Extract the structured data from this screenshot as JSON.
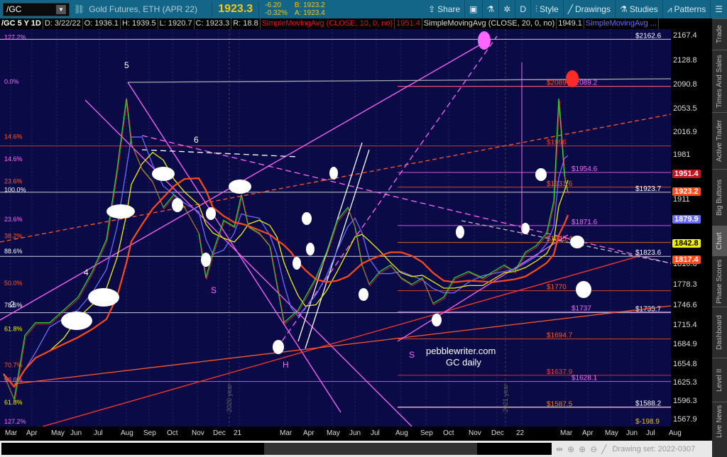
{
  "toolbar": {
    "symbol": "/GC",
    "description": "Gold Futures, ETH (APR 22)",
    "last": "1923.3",
    "change": "-6.20",
    "change_pct": "-0.32%",
    "bid": "B: 1923.2",
    "ask": "A: 1923.4",
    "share": "Share",
    "period": "D",
    "style": "Style",
    "drawings": "Drawings",
    "studies": "Studies",
    "patterns": "Patterns"
  },
  "info": {
    "title": "/GC 5 Y 1D",
    "date": "D: 3/22/22",
    "open": "O: 1936.1",
    "high": "H: 1939.5",
    "low": "L: 1920.7",
    "close": "C: 1923.3",
    "range": "R: 18.8",
    "sma10": "SimpleMovingAvg (CLOSE, 10, 0, no)",
    "sma10_val": "1951.4",
    "sma20": "SimpleMovingAvg (CLOSE, 20, 0, no)",
    "sma20_val": "1949.1",
    "sma3": "SimpleMovingAvg ..."
  },
  "price_axis": {
    "ticks": [
      "2167.4",
      "2128.8",
      "2090.8",
      "2053.5",
      "2016.9",
      "1981",
      "1911",
      "1810.6",
      "1778.3",
      "1746.6",
      "1715.4",
      "1684.9",
      "1654.8",
      "1625.3",
      "1596.3",
      "1567.9"
    ],
    "tags": [
      {
        "label": "1951.4",
        "price": 1951.4,
        "bg": "#c0141e",
        "fg": "#fff"
      },
      {
        "label": "1923.2",
        "price": 1923.2,
        "bg": "#ff4a1a",
        "fg": "#fff"
      },
      {
        "label": "1879.9",
        "price": 1879.9,
        "bg": "#6b6bff",
        "fg": "#fff"
      },
      {
        "label": "1842.8",
        "price": 1842.8,
        "bg": "#f0f000",
        "fg": "#000"
      },
      {
        "label": "1817.4",
        "price": 1817.4,
        "bg": "#ff4a1a",
        "fg": "#fff"
      }
    ]
  },
  "x_axis": [
    "Mar",
    "Apr",
    "May",
    "Jun",
    "Jul",
    "Aug",
    "Sep",
    "Oct",
    "Nov",
    "Dec",
    "21",
    "Mar",
    "Apr",
    "May",
    "Jun",
    "Jul",
    "Aug",
    "Sep",
    "Oct",
    "Nov",
    "Dec",
    "22",
    "Mar",
    "Apr",
    "May",
    "Jun",
    "Jul",
    "Aug"
  ],
  "levels": [
    {
      "price": 2162.6,
      "label": "$2162.6",
      "color": "#ffffff"
    },
    {
      "price": 2089.2,
      "label": "$2089.2",
      "color": "#ff66ff"
    },
    {
      "price": 2089,
      "label": "$2089",
      "color": "#ff5a2a"
    },
    {
      "price": 1996,
      "label": "$1996",
      "color": "#ff3a2a"
    },
    {
      "price": 1954.6,
      "label": "$1954.6",
      "color": "#ff66ff"
    },
    {
      "price": 1931.6,
      "label": "$1931.6",
      "color": "#ff5a2a"
    },
    {
      "price": 1923.7,
      "label": "$1923.7",
      "color": "#ffffff"
    },
    {
      "price": 1871.6,
      "label": "$1871.6",
      "color": "#ff66ff"
    },
    {
      "price": 1845.4,
      "label": "$1845.4",
      "color": "#ff7a2a"
    },
    {
      "price": 1823.6,
      "label": "$1823.6",
      "color": "#ffffff"
    },
    {
      "price": 1770,
      "label": "$1770",
      "color": "#ff5a2a"
    },
    {
      "price": 1737,
      "label": "$1737",
      "color": "#ff66ff"
    },
    {
      "price": 1735.7,
      "label": "$1735.7",
      "color": "#ffffff"
    },
    {
      "price": 1694.7,
      "label": "$1694.7",
      "color": "#ff5a2a"
    },
    {
      "price": 1637.9,
      "label": "$1637.9",
      "color": "#ff3a2a"
    },
    {
      "price": 1628.1,
      "label": "$1628.1",
      "color": "#ff66ff"
    },
    {
      "price": 1587.5,
      "label": "$1587.5",
      "color": "#ff7a2a"
    },
    {
      "price": 1588.2,
      "label": "$1588.2",
      "color": "#ffffff"
    },
    {
      "price": 1552,
      "label": "$-198.9",
      "color": "#f0c000"
    }
  ],
  "fib_labels": [
    {
      "price": 2160,
      "label": "127.2%",
      "color": "#ff66ff"
    },
    {
      "price": 2091,
      "label": "0.0%",
      "color": "#ff66ff"
    },
    {
      "price": 2005,
      "label": "14.6%",
      "color": "#ff5a2a"
    },
    {
      "price": 1970,
      "label": "14.6%",
      "color": "#ff66ff"
    },
    {
      "price": 1935,
      "label": "23.6%",
      "color": "#ff5a2a"
    },
    {
      "price": 1922,
      "label": "100.0%",
      "color": "#ffffff"
    },
    {
      "price": 1876,
      "label": "23.6%",
      "color": "#ff66ff"
    },
    {
      "price": 1850,
      "label": "38.2%",
      "color": "#ff5a2a"
    },
    {
      "price": 1826,
      "label": "88.6%",
      "color": "#ffffff"
    },
    {
      "price": 1776,
      "label": "50.0%",
      "color": "#ff5a2a"
    },
    {
      "price": 1742,
      "label": "78.6%",
      "color": "#ffffff"
    },
    {
      "price": 1705,
      "label": "61.8%",
      "color": "#f0f000"
    },
    {
      "price": 1648,
      "label": "70.7%",
      "color": "#ff5a2a"
    },
    {
      "price": 1625,
      "label": "50.0%",
      "color": "#ff66ff"
    },
    {
      "price": 1590,
      "label": "61.8%",
      "color": "#f0f000"
    },
    {
      "price": 1555,
      "label": "127.2%",
      "color": "#ff66ff"
    }
  ],
  "annotations": {
    "w5": "5",
    "w6": "6",
    "w4": "4",
    "w2": "2",
    "s1": "S",
    "h": "H",
    "s2": "S",
    "site": "pebblewriter.com",
    "subtitle": "GC daily",
    "y2020": "2020 year",
    "y2021": "2021 year"
  },
  "price_series": [
    [
      5,
      1640
    ],
    [
      20,
      1600
    ],
    [
      35,
      1700
    ],
    [
      50,
      1720
    ],
    [
      70,
      1720
    ],
    [
      90,
      1740
    ],
    [
      110,
      1760
    ],
    [
      130,
      1800
    ],
    [
      150,
      1850
    ],
    [
      165,
      1960
    ],
    [
      178,
      2070
    ],
    [
      185,
      2000
    ],
    [
      200,
      1960
    ],
    [
      215,
      1940
    ],
    [
      230,
      1900
    ],
    [
      245,
      1920
    ],
    [
      260,
      1900
    ],
    [
      280,
      1860
    ],
    [
      290,
      1790
    ],
    [
      300,
      1830
    ],
    [
      315,
      1880
    ],
    [
      330,
      1870
    ],
    [
      340,
      1920
    ],
    [
      350,
      1870
    ],
    [
      365,
      1860
    ],
    [
      380,
      1840
    ],
    [
      390,
      1780
    ],
    [
      400,
      1720
    ],
    [
      410,
      1730
    ],
    [
      420,
      1740
    ],
    [
      430,
      1760
    ],
    [
      445,
      1790
    ],
    [
      460,
      1830
    ],
    [
      475,
      1880
    ],
    [
      490,
      1900
    ],
    [
      500,
      1870
    ],
    [
      510,
      1810
    ],
    [
      520,
      1780
    ],
    [
      535,
      1800
    ],
    [
      550,
      1810
    ],
    [
      565,
      1790
    ],
    [
      580,
      1780
    ],
    [
      595,
      1790
    ],
    [
      610,
      1750
    ],
    [
      625,
      1760
    ],
    [
      640,
      1790
    ],
    [
      660,
      1800
    ],
    [
      680,
      1790
    ],
    [
      695,
      1800
    ],
    [
      710,
      1810
    ],
    [
      725,
      1800
    ],
    [
      740,
      1830
    ],
    [
      755,
      1840
    ],
    [
      770,
      1860
    ],
    [
      780,
      1910
    ],
    [
      787,
      2070
    ],
    [
      795,
      1950
    ],
    [
      800,
      1923
    ]
  ],
  "sidebar": [
    "Trade",
    "Times And Sales",
    "Active Trader",
    "Big Buttons",
    "Chart",
    "Phase Scores",
    "Dashboard",
    "Level II",
    "Live News"
  ],
  "bottom": {
    "drawing_set": "Drawing set: 2022-0307"
  }
}
